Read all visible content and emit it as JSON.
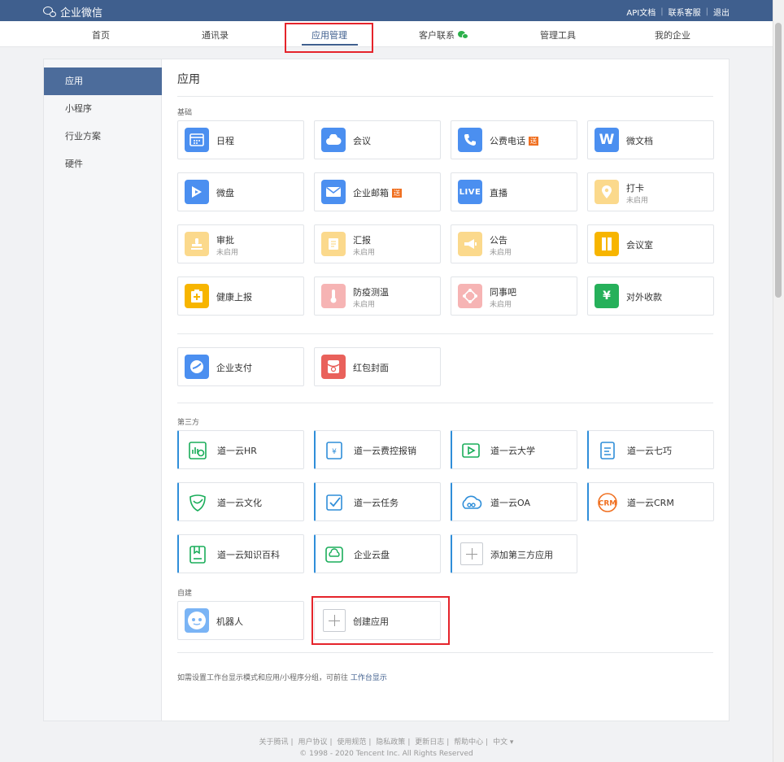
{
  "topbar": {
    "logo_text": "企业微信",
    "links": [
      "API文档",
      "联系客服",
      "退出"
    ],
    "separator": "|"
  },
  "nav": {
    "items": [
      "首页",
      "通讯录",
      "应用管理",
      "客户联系",
      "管理工具",
      "我的企业"
    ],
    "active_index": 2
  },
  "sidebar": {
    "items": [
      "应用",
      "小程序",
      "行业方案",
      "硬件"
    ],
    "active_index": 0
  },
  "main": {
    "title": "应用",
    "section_basic": "基础",
    "section_third": "第三方",
    "section_custom": "自建",
    "disabled_label": "未启用",
    "badge_label": "送",
    "basic_apps": [
      {
        "name": "日程",
        "icon": "calendar-icon",
        "color": "#4b8ff0"
      },
      {
        "name": "会议",
        "icon": "cloud-meeting-icon",
        "color": "#4b8ff0"
      },
      {
        "name": "公费电话",
        "icon": "phone-icon",
        "color": "#4b8ff0",
        "badge": true
      },
      {
        "name": "微文档",
        "icon": "w-doc-icon",
        "color": "#4b8ff0"
      },
      {
        "name": "微盘",
        "icon": "disk-icon",
        "color": "#4b8ff0"
      },
      {
        "name": "企业邮箱",
        "icon": "mail-icon",
        "color": "#4b8ff0",
        "badge": true
      },
      {
        "name": "直播",
        "icon": "live-icon",
        "color": "#4b8ff0",
        "icon_text": "LIVE"
      },
      {
        "name": "打卡",
        "icon": "location-pin-icon",
        "color": "#fbd98c",
        "disabled": true
      },
      {
        "name": "审批",
        "icon": "stamp-icon",
        "color": "#fbd98c",
        "disabled": true
      },
      {
        "name": "汇报",
        "icon": "report-icon",
        "color": "#fbd98c",
        "disabled": true
      },
      {
        "name": "公告",
        "icon": "megaphone-icon",
        "color": "#fbd98c",
        "disabled": true
      },
      {
        "name": "会议室",
        "icon": "door-icon",
        "color": "#f7b500"
      },
      {
        "name": "健康上报",
        "icon": "health-report-icon",
        "color": "#f7b500"
      },
      {
        "name": "防疫测温",
        "icon": "thermometer-icon",
        "color": "#f6b4b4",
        "disabled": true
      },
      {
        "name": "同事吧",
        "icon": "colleague-icon",
        "color": "#f6b4b4",
        "disabled": true
      },
      {
        "name": "对外收款",
        "icon": "payment-icon",
        "color": "#26b05a"
      }
    ],
    "extra_apps": [
      {
        "name": "企业支付",
        "icon": "enterprise-pay-icon",
        "color": "#4b8ff0"
      },
      {
        "name": "红包封面",
        "icon": "red-packet-icon",
        "color": "#e9615b"
      }
    ],
    "third_apps": [
      {
        "name": "道一云HR",
        "icon": "hr-icon",
        "color": "#1aad5a"
      },
      {
        "name": "道一云费控报销",
        "icon": "expense-icon",
        "color": "#2f8ed9"
      },
      {
        "name": "道一云大学",
        "icon": "university-icon",
        "color": "#1aad5a"
      },
      {
        "name": "道一云七巧",
        "icon": "qiqiao-icon",
        "color": "#2f8ed9"
      },
      {
        "name": "道一云文化",
        "icon": "culture-icon",
        "color": "#1aad5a"
      },
      {
        "name": "道一云任务",
        "icon": "task-icon",
        "color": "#2f8ed9"
      },
      {
        "name": "道一云OA",
        "icon": "oa-icon",
        "color": "#2f8ed9"
      },
      {
        "name": "道一云CRM",
        "icon": "crm-icon",
        "color": "#f07021",
        "icon_text": "CRM"
      },
      {
        "name": "道一云知识百科",
        "icon": "wiki-icon",
        "color": "#1aad5a"
      },
      {
        "name": "企业云盘",
        "icon": "cloud-disk-icon",
        "color": "#1aad5a"
      },
      {
        "name": "添加第三方应用",
        "icon": "plus-icon",
        "color": "#999999"
      }
    ],
    "custom_apps": [
      {
        "name": "机器人",
        "icon": "robot-icon",
        "color": "#7ab4f5"
      },
      {
        "name": "创建应用",
        "icon": "plus-icon",
        "color": "#999999"
      }
    ],
    "note_text": "如需设置工作台显示模式和应用/小程序分组，可前往",
    "note_link": "工作台显示"
  },
  "footer": {
    "links": [
      "关于腾讯",
      "用户协议",
      "使用规范",
      "隐私政策",
      "更新日志",
      "帮助中心",
      "中文 ▾"
    ],
    "copyright": "© 1998 - 2020 Tencent Inc. All Rights Reserved"
  },
  "colors": {
    "brand": "#3f5f8e",
    "highlight_red": "#e5242b",
    "badge_orange": "#f07021"
  }
}
